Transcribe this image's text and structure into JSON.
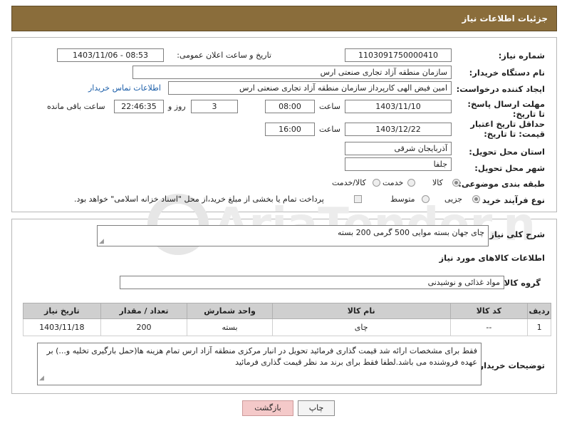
{
  "header": {
    "title": "جزئیات اطلاعات نیاز"
  },
  "need": {
    "number_label": "شماره نیاز:",
    "number": "1103091750000410",
    "announce_label": "تاریخ و ساعت اعلان عمومی:",
    "announce": "1403/11/06 - 08:53",
    "buyer_label": "نام دستگاه خریدار:",
    "buyer": "سازمان منطقه آزاد تجاری صنعتی ارس",
    "creator_label": "ایجاد کننده درخواست:",
    "creator": "امین فیض الهی کارپرداز سازمان منطقه آزاد تجاری صنعتی ارس",
    "contact_link": "اطلاعات تماس خریدار",
    "deadline_label": "مهلت ارسال پاسخ: تا تاریخ:",
    "deadline_date": "1403/11/10",
    "hour_label": "ساعت",
    "deadline_time": "08:00",
    "days": "3",
    "days_label": "روز و",
    "remaining": "22:46:35",
    "remaining_label": "ساعت باقی مانده",
    "validity_label": "حداقل تاریخ اعتبار قیمت: تا تاریخ:",
    "validity_date": "1403/12/22",
    "validity_time": "16:00",
    "province_label": "استان محل تحویل:",
    "province": "آذربایجان شرقی",
    "city_label": "شهر محل تحویل:",
    "city": "جلفا",
    "category_label": "طبقه بندی موضوعی:",
    "category_options": [
      "کالا",
      "خدمت",
      "کالا/خدمت"
    ],
    "category_selected": "کالا",
    "process_label": "نوع فرآیند خرید :",
    "process_options": [
      "جزیی",
      "متوسط"
    ],
    "process_selected": "جزیی",
    "payment_note": "پرداخت تمام یا بخشی از مبلغ خرید،از محل \"اسناد خزانه اسلامی\" خواهد بود."
  },
  "summary": {
    "label": "شرح کلی نیاز:",
    "text": "چای جهان بسته موایی 500 گرمی 200 بسته"
  },
  "goods": {
    "section_title": "اطلاعات کالاهای مورد نیاز",
    "group_label": "گروه کالا:",
    "group": "مواد غذائی و نوشیدنی",
    "columns": [
      "ردیف",
      "کد کالا",
      "نام کالا",
      "واحد شمارش",
      "تعداد / مقدار",
      "تاریخ نیاز"
    ],
    "rows": [
      [
        "1",
        "--",
        "چای",
        "بسته",
        "200",
        "1403/11/18"
      ]
    ]
  },
  "buyer_notes": {
    "label": "توضیحات خریدار:",
    "text": "فقط برای مشخصات ارائه شد قیمت گذاری فرمائید تحویل در انبار مرکزی منطقه آزاد ارس تمام هزینه ها(حمل بارگیری تخلیه و...) بر عهده فروشنده می باشد.لطفا فقط برای برند مد نظر قیمت گذاری فرمائید"
  },
  "buttons": {
    "print": "چاپ",
    "back": "بازگشت"
  },
  "colors": {
    "header": "#8a6d3b",
    "table_header": "#cfcfcf",
    "back_button": "#f4c9c9",
    "link": "#1a5da8"
  },
  "watermark": "AriaTender.net"
}
